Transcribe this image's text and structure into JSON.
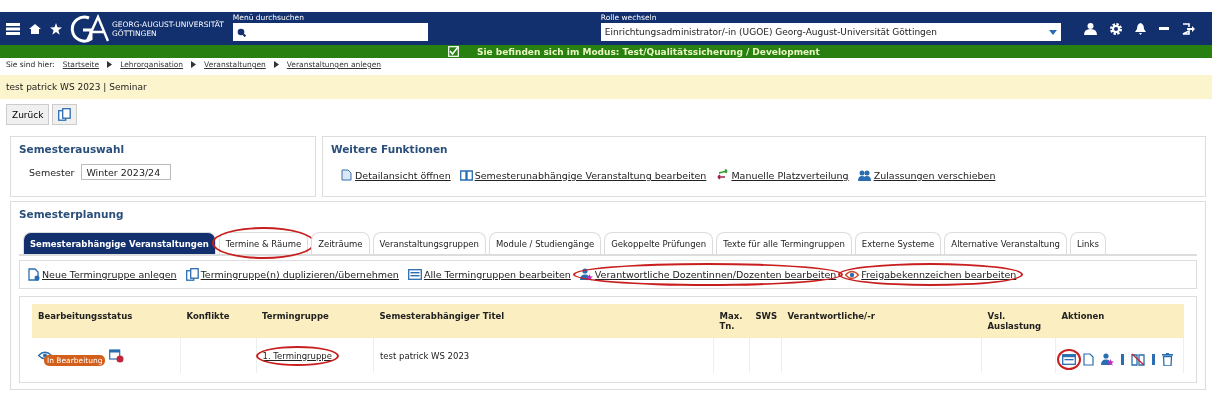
{
  "header": {
    "logo_line1": "GEORG-AUGUST-UNIVERSITÄT",
    "logo_line2": "GÖTTINGEN",
    "search_label": "Menü durchsuchen",
    "role_label": "Rolle wechseln",
    "role_value": "Einrichtungsadministrator/-in (UGOE) Georg-August-Universität Göttingen"
  },
  "mode_bar": {
    "checked": true,
    "text": "Sie befinden sich im Modus: Test/Qualitätssicherung / Development"
  },
  "breadcrumb": {
    "label": "Sie sind hier:",
    "items": [
      "Startseite",
      "Lehrorganisation",
      "Veranstaltungen",
      "Veranstaltungen anlegen"
    ]
  },
  "page_title": "test patrick WS 2023 | Seminar",
  "back_button": "Zurück",
  "semester_panel": {
    "title": "Semesterauswahl",
    "label": "Semester",
    "value": "Winter 2023/24"
  },
  "functions_panel": {
    "title": "Weitere Funktionen",
    "links": [
      {
        "kind": "detail",
        "label": "Detailansicht öffnen"
      },
      {
        "kind": "book",
        "label": "Semesterunabhängige Veranstaltung bearbeiten"
      },
      {
        "kind": "swap",
        "label": "Manuelle Platzverteilung"
      },
      {
        "kind": "people",
        "label": "Zulassungen verschieben"
      }
    ]
  },
  "planning": {
    "title": "Semesterplanung",
    "tabs": [
      {
        "label": "Semesterabhängige Veranstaltungen",
        "selected": true,
        "circled": false
      },
      {
        "label": "Termine & Räume",
        "selected": false,
        "circled": true
      },
      {
        "label": "Zeiträume",
        "selected": false,
        "circled": false
      },
      {
        "label": "Veranstaltungsgruppen",
        "selected": false,
        "circled": false
      },
      {
        "label": "Module / Studiengänge",
        "selected": false,
        "circled": false
      },
      {
        "label": "Gekoppelte Prüfungen",
        "selected": false,
        "circled": false
      },
      {
        "label": "Texte für alle Termingruppen",
        "selected": false,
        "circled": false
      },
      {
        "label": "Externe Systeme",
        "selected": false,
        "circled": false
      },
      {
        "label": "Alternative Veranstaltung",
        "selected": false,
        "circled": false
      },
      {
        "label": "Links",
        "selected": false,
        "circled": false
      }
    ],
    "actions": [
      {
        "kind": "new",
        "label": "Neue Termingruppe anlegen",
        "circled": false
      },
      {
        "kind": "copy",
        "label": "Termingruppe(n) duplizieren/übernehmen",
        "circled": false
      },
      {
        "kind": "table",
        "label": "Alle Termingruppen bearbeiten",
        "circled": false
      },
      {
        "kind": "person",
        "label": "Verantwortliche Dozentinnen/Dozenten bearbeiten",
        "circled": true
      },
      {
        "kind": "eye",
        "label": "Freigabekennzeichen bearbeiten",
        "circled": true
      }
    ],
    "table": {
      "columns": [
        "Bearbeitungsstatus",
        "Konflikte",
        "Termingruppe",
        "Semesterabhängiger Titel",
        "Max. Tn.",
        "SWS",
        "Verantwortliche/-r",
        "Vsl. Auslastung",
        "Aktionen"
      ],
      "rows": [
        {
          "status": "In Bearbeitung",
          "termingruppe": "1. Termingruppe",
          "termingruppe_circled": true,
          "title": "test patrick WS 2023",
          "edit_circled": true
        }
      ]
    }
  }
}
